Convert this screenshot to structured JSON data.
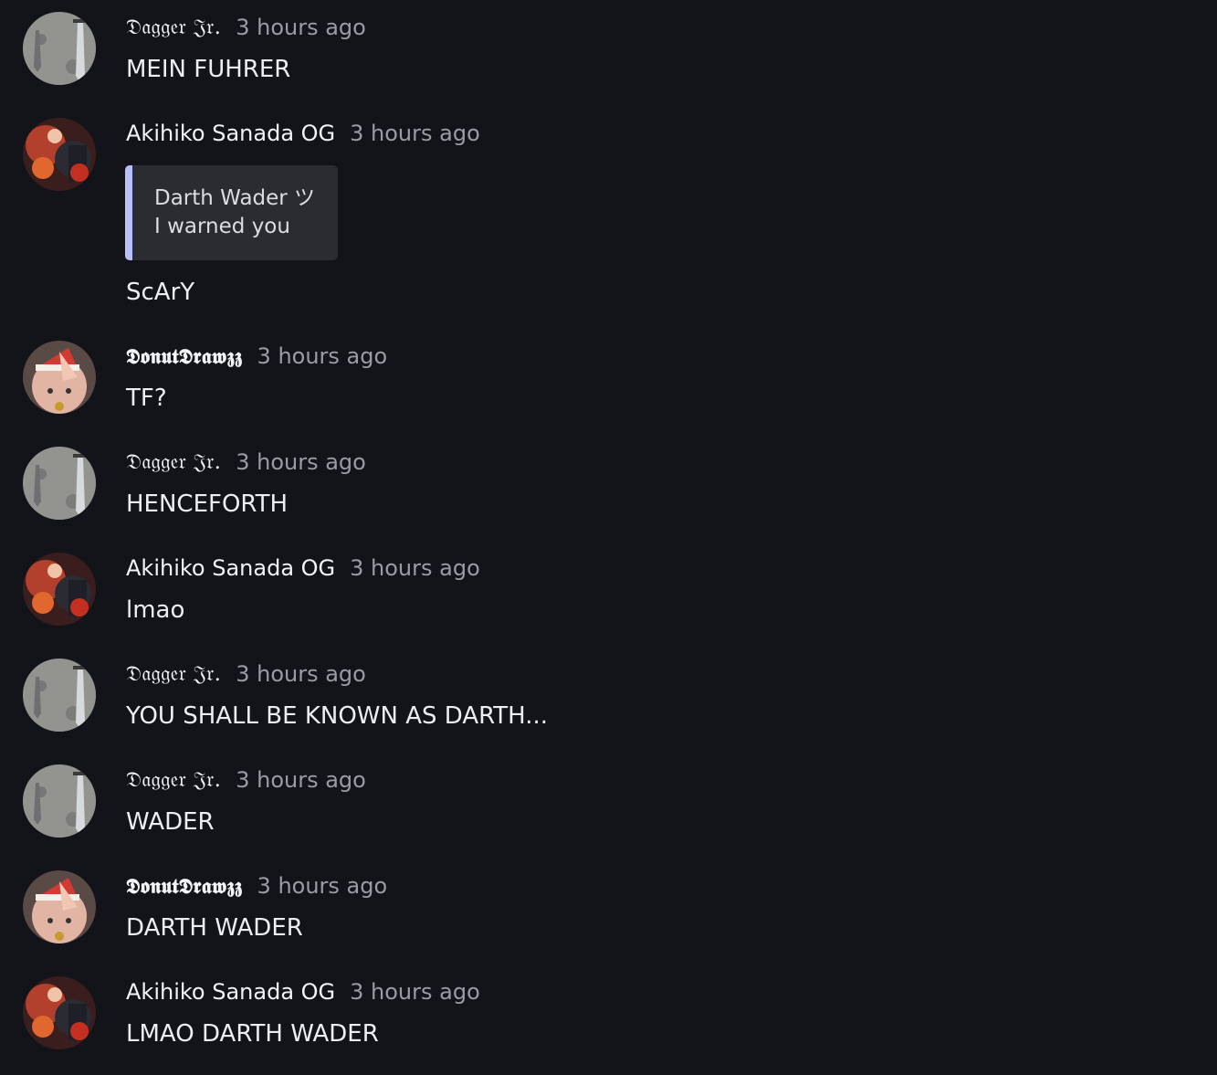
{
  "messages": [
    {
      "author": "𝔇𝔞𝔤𝔤𝔢𝔯 𝔍𝔯.",
      "time": "3 hours ago",
      "text": "MEIN FUHRER",
      "avatar": "dagger-avatar"
    },
    {
      "author": "Akihiko Sanada OG",
      "time": "3 hours ago",
      "quote": {
        "author": "Darth Wader ツ",
        "text": "I warned you"
      },
      "text": "ScArY",
      "avatar": "akihiko-avatar"
    },
    {
      "author": "𝕯𝖔𝖓𝖚𝖙𝕯𝖗𝖆𝖜𝖟𝖟",
      "time": "3 hours ago",
      "text": "TF?",
      "avatar": "donut-avatar"
    },
    {
      "author": "𝔇𝔞𝔤𝔤𝔢𝔯 𝔍𝔯.",
      "time": "3 hours ago",
      "text": "HENCEFORTH",
      "avatar": "dagger-avatar"
    },
    {
      "author": "Akihiko Sanada OG",
      "time": "3 hours ago",
      "text": "lmao",
      "avatar": "akihiko-avatar"
    },
    {
      "author": "𝔇𝔞𝔤𝔤𝔢𝔯 𝔍𝔯.",
      "time": "3 hours ago",
      "text": "YOU SHALL BE KNOWN AS DARTH...",
      "avatar": "dagger-avatar"
    },
    {
      "author": "𝔇𝔞𝔤𝔤𝔢𝔯 𝔍𝔯.",
      "time": "3 hours ago",
      "text": "WADER",
      "avatar": "dagger-avatar"
    },
    {
      "author": "𝕯𝖔𝖓𝖚𝖙𝕯𝖗𝖆𝖜𝖟𝖟",
      "time": "3 hours ago",
      "text": "DARTH WADER",
      "avatar": "donut-avatar"
    },
    {
      "author": "Akihiko Sanada OG",
      "time": "3 hours ago",
      "text": "LMAO DARTH WADER",
      "avatar": "akihiko-avatar"
    }
  ],
  "colors": {
    "background": "#131419",
    "quote_bar": "#b9bffb",
    "quote_bg": "#2a2c31",
    "timestamp": "#9a9ca3"
  }
}
